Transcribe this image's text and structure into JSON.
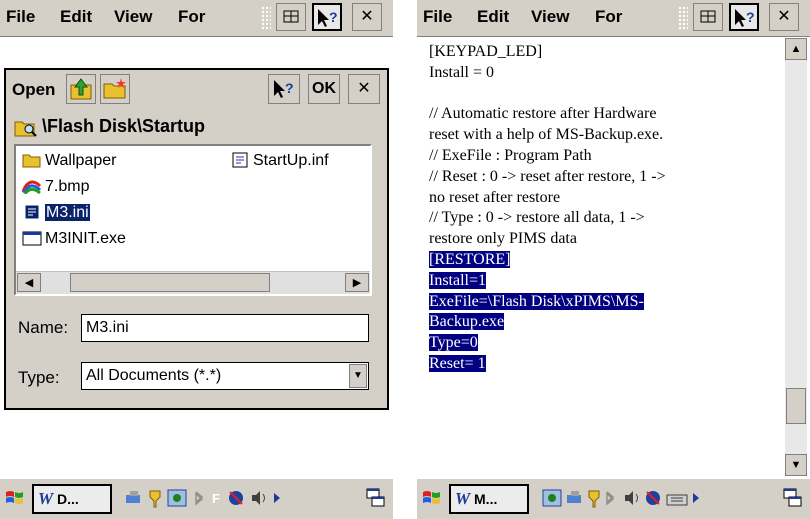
{
  "left": {
    "menu": {
      "file": "File",
      "edit": "Edit",
      "view": "View",
      "format": "For"
    },
    "dialog": {
      "title": "Open",
      "ok_label": "OK",
      "close_label": "×",
      "help_label": "?",
      "path": "\\Flash Disk\\Startup",
      "files": [
        "Wallpaper",
        "StartUp.inf",
        "7.bmp",
        "M3.ini",
        "M3INIT.exe"
      ],
      "name_label": "Name:",
      "name_value": "M3.ini",
      "type_label": "Type:",
      "type_value": "All Documents (*.*)"
    },
    "taskbar": {
      "task_label": "D..."
    }
  },
  "right": {
    "menu": {
      "file": "File",
      "edit": "Edit",
      "view": "View",
      "format": "For"
    },
    "lines": [
      "[KEYPAD_LED]",
      "Install = 0",
      "",
      "// Automatic restore after Hardware",
      "reset with a help of MS-Backup.exe.",
      "// ExeFile : Program Path",
      "// Reset : 0 -> reset after restore, 1 ->",
      "no reset after restore",
      "// Type : 0 -> restore all data, 1 ->",
      "restore only PIMS data"
    ],
    "selected_lines": [
      "[RESTORE]",
      "Install=1",
      "ExeFile=\\Flash Disk\\xPIMS\\MS-",
      "Backup.exe",
      "Type=0",
      "Reset= 1"
    ],
    "taskbar": {
      "task_label": "M..."
    }
  },
  "colors": {
    "selection": "#000080",
    "chrome": "#d4d0c8"
  }
}
